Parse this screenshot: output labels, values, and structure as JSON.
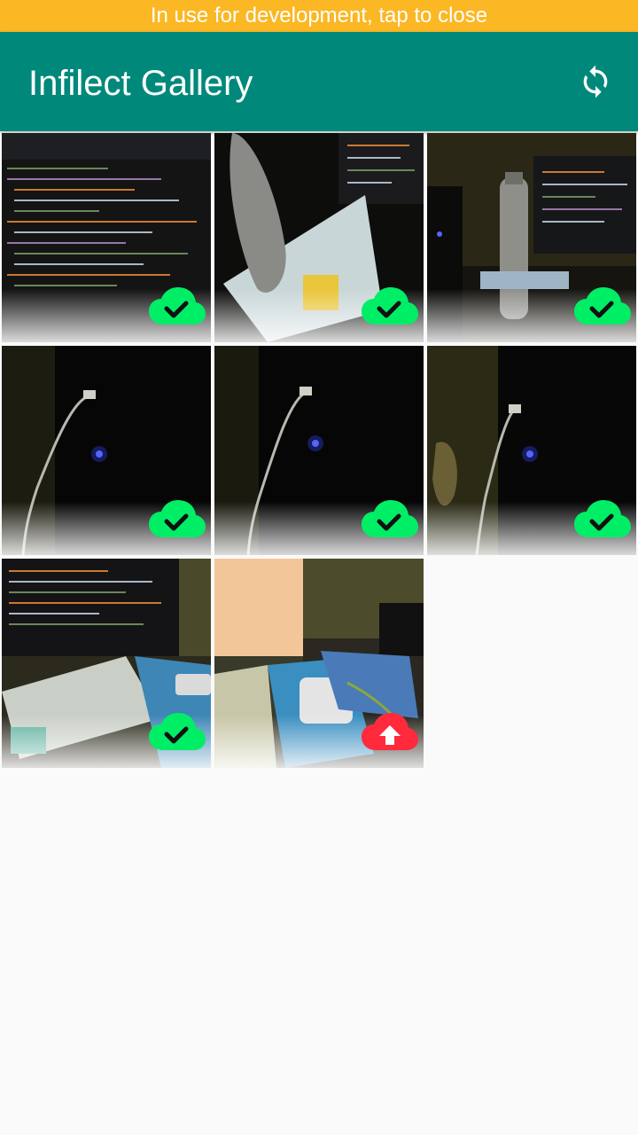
{
  "dev_banner": {
    "text": "In use for development, tap to close"
  },
  "app_bar": {
    "title": "Infilect Gallery",
    "sync_icon": "sync-icon"
  },
  "colors": {
    "banner": "#fbb724",
    "app_bar": "#00897b",
    "synced": "#00ee66",
    "pending": "#ff2a3c"
  },
  "gallery": {
    "images": [
      {
        "scene": "code-screen",
        "status": "uploaded"
      },
      {
        "scene": "bottle-book",
        "status": "uploaded"
      },
      {
        "scene": "bottle-monitor",
        "status": "uploaded"
      },
      {
        "scene": "dark-cable",
        "status": "uploaded"
      },
      {
        "scene": "dark-cable",
        "status": "uploaded"
      },
      {
        "scene": "dark-cable-yellow",
        "status": "uploaded"
      },
      {
        "scene": "desk-books",
        "status": "uploaded"
      },
      {
        "scene": "desk-monitor",
        "status": "pending-upload"
      }
    ]
  }
}
